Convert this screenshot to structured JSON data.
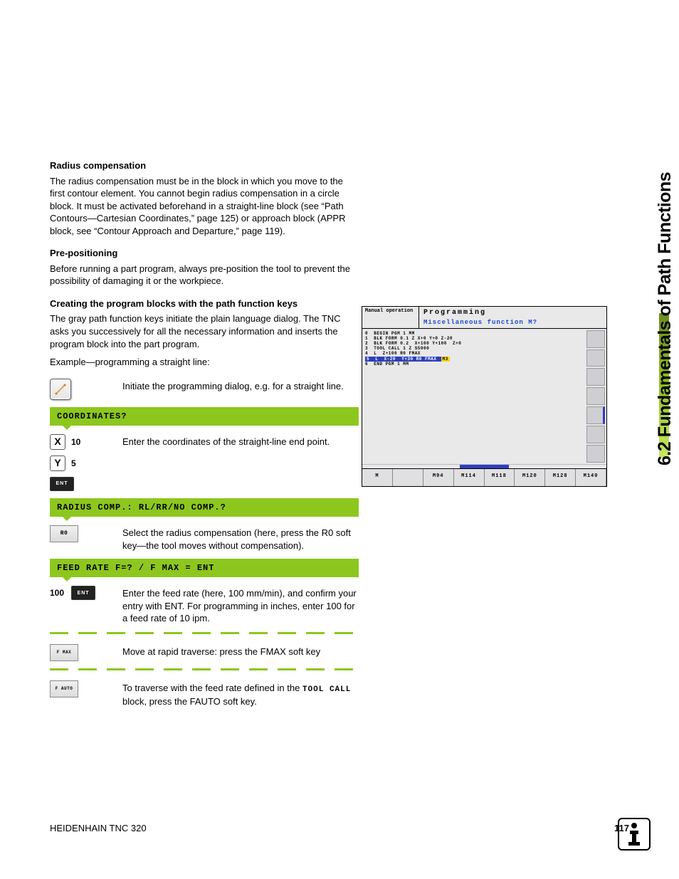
{
  "section_tab": "6.2 Fundamentals of Path Functions",
  "headings": {
    "radius": "Radius compensation",
    "prepos": "Pre-positioning",
    "creating": "Creating the program blocks with the path function keys"
  },
  "para": {
    "radius": "The radius compensation must be in the block in which you move to the first contour element. You cannot begin radius compensation in a circle block. It must be activated beforehand in a straight-line block (see “Path Contours—Cartesian Coordinates,” page 125) or approach block (APPR block, see “Contour Approach and Departure,” page 119).",
    "prepos": "Before running a part program, always pre-position the tool to prevent the possibility of damaging it or the workpiece.",
    "creating": "The gray path function keys initiate the plain language dialog. The TNC asks you successively for all the necessary information and inserts the program block into the part program.",
    "example": "Example—programming a straight line:",
    "step_line": "Initiate the programming dialog, e.g. for a straight line.",
    "step_coord": "Enter the coordinates of the straight-line end point.",
    "step_r0": "Select the radius compensation (here, press the R0 soft key—the tool moves without compensation).",
    "step_feed": "Enter the feed rate (here, 100 mm/min), and confirm your entry with ENT. For programming in inches, enter 100 for a feed rate of 10 ipm.",
    "step_fmax": "Move at rapid traverse: press the FMAX soft key",
    "step_fauto_a": "To traverse with the feed rate defined in the ",
    "step_fauto_b": " block, press the FAUTO soft key."
  },
  "tool_call": "TOOL CALL",
  "prompts": {
    "coord": "COORDINATES?",
    "radius": "RADIUS COMP.: RL/RR/NO COMP.?",
    "feed": "FEED RATE F=? / F MAX = ENT"
  },
  "keys": {
    "x": "X",
    "y": "Y",
    "x_val": "10",
    "y_val": "5",
    "ent": "ENT",
    "r0": "R0",
    "feed_val": "100",
    "fmax": "F MAX",
    "fauto": "F AUTO"
  },
  "screen": {
    "mode": "Manual operation",
    "title": "Programming",
    "subtitle": "Miscellaneous function M?",
    "code": [
      "0  BEGIN PGM 1 MM",
      "1  BLK FORM 0.1 Z X+0 Y+0 Z-20",
      "2  BLK FORM 0.2  X+100 Y+100  Z+0",
      "3  TOOL CALL 1 Z S5000",
      "4  L  Z+100 R0 FMAX"
    ],
    "code_hl_blue": "5  L  X-20  Y+30 R0 FMAX ",
    "code_hl_yellow": "M3",
    "code_after": "6  END PGM 1 MM",
    "softkeys": [
      "M",
      "",
      "M94",
      "M114",
      "M118",
      "M120",
      "M128",
      "M140"
    ]
  },
  "footer": {
    "left": "HEIDENHAIN TNC 320",
    "page": "117"
  }
}
